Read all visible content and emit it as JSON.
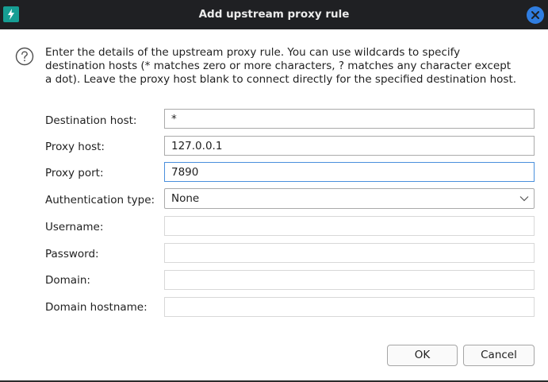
{
  "window": {
    "title": "Add upstream proxy rule",
    "app_icon": "lightning-bolt-icon",
    "close_icon": "close-x-icon"
  },
  "intro": {
    "icon": "question-circle-icon",
    "line1": "Enter the details of the upstream proxy rule. You can use wildcards to specify",
    "line2": "destination hosts (* matches zero or more characters, ? matches any character except",
    "line3": "a dot). Leave the proxy host blank to connect directly for the specified destination host."
  },
  "form": {
    "destination_host": {
      "label": "Destination host:",
      "value": "*"
    },
    "proxy_host": {
      "label": "Proxy host:",
      "value": "127.0.0.1"
    },
    "proxy_port": {
      "label": "Proxy port:",
      "value": "7890"
    },
    "auth_type": {
      "label": "Authentication type:",
      "value": "None"
    },
    "username": {
      "label": "Username:",
      "value": ""
    },
    "password": {
      "label": "Password:",
      "value": ""
    },
    "domain": {
      "label": "Domain:",
      "value": ""
    },
    "domain_hostname": {
      "label": "Domain hostname:",
      "value": ""
    }
  },
  "buttons": {
    "ok": "OK",
    "cancel": "Cancel"
  },
  "colors": {
    "titlebar": "#1f2023",
    "app_icon_bg": "#169e94",
    "close_button": "#2f7de1",
    "focus_border": "#4a8fdc"
  }
}
